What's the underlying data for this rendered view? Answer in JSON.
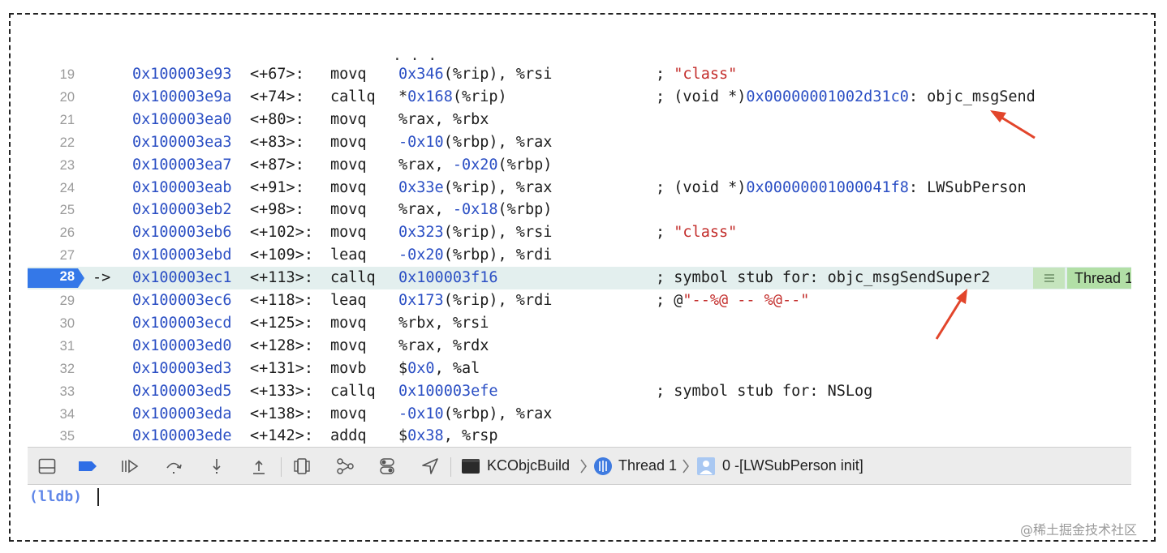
{
  "disassembly": {
    "partial_top_text": ".  .  .",
    "rows": [
      {
        "line": "19",
        "addr": "0x100003e93",
        "offset": "<+67>:",
        "mnemonic": "movq",
        "op_a": "0x346",
        "op_b": "(%rip), %rsi",
        "op_c": "",
        "op_d": "",
        "cm_a": "; ",
        "cm_b": "",
        "cm_c": "\"class\"",
        "cm_d": ""
      },
      {
        "line": "20",
        "addr": "0x100003e9a",
        "offset": "<+74>:",
        "mnemonic": "callq",
        "op_a": "",
        "op_b": "*",
        "op_c": "0x168",
        "op_d": "(%rip)",
        "cm_a": "; (void *)",
        "cm_b": "0x00000001002d31c0",
        "cm_c": "",
        "cm_d": ": objc_msgSend"
      },
      {
        "line": "21",
        "addr": "0x100003ea0",
        "offset": "<+80>:",
        "mnemonic": "movq",
        "op_a": "",
        "op_b": "%rax, %rbx",
        "op_c": "",
        "op_d": "",
        "cm_a": "",
        "cm_b": "",
        "cm_c": "",
        "cm_d": ""
      },
      {
        "line": "22",
        "addr": "0x100003ea3",
        "offset": "<+83>:",
        "mnemonic": "movq",
        "op_a": "-0x10",
        "op_b": "(%rbp), %rax",
        "op_c": "",
        "op_d": "",
        "cm_a": "",
        "cm_b": "",
        "cm_c": "",
        "cm_d": ""
      },
      {
        "line": "23",
        "addr": "0x100003ea7",
        "offset": "<+87>:",
        "mnemonic": "movq",
        "op_a": "",
        "op_b": "%rax, ",
        "op_c": "-0x20",
        "op_d": "(%rbp)",
        "cm_a": "",
        "cm_b": "",
        "cm_c": "",
        "cm_d": ""
      },
      {
        "line": "24",
        "addr": "0x100003eab",
        "offset": "<+91>:",
        "mnemonic": "movq",
        "op_a": "0x33e",
        "op_b": "(%rip), %rax",
        "op_c": "",
        "op_d": "",
        "cm_a": "; (void *)",
        "cm_b": "0x00000001000041f8",
        "cm_c": "",
        "cm_d": ": LWSubPerson"
      },
      {
        "line": "25",
        "addr": "0x100003eb2",
        "offset": "<+98>:",
        "mnemonic": "movq",
        "op_a": "",
        "op_b": "%rax, ",
        "op_c": "-0x18",
        "op_d": "(%rbp)",
        "cm_a": "",
        "cm_b": "",
        "cm_c": "",
        "cm_d": ""
      },
      {
        "line": "26",
        "addr": "0x100003eb6",
        "offset": "<+102>:",
        "mnemonic": "movq",
        "op_a": "0x323",
        "op_b": "(%rip), %rsi",
        "op_c": "",
        "op_d": "",
        "cm_a": "; ",
        "cm_b": "",
        "cm_c": "\"class\"",
        "cm_d": ""
      },
      {
        "line": "27",
        "addr": "0x100003ebd",
        "offset": "<+109>:",
        "mnemonic": "leaq",
        "op_a": "-0x20",
        "op_b": "(%rbp), %rdi",
        "op_c": "",
        "op_d": "",
        "cm_a": "",
        "cm_b": "",
        "cm_c": "",
        "cm_d": ""
      },
      {
        "line": "28",
        "addr": "0x100003ec1",
        "offset": "<+113>:",
        "mnemonic": "callq",
        "op_a": "0x100003f16",
        "op_b": "",
        "op_c": "",
        "op_d": "",
        "cm_a": "; symbol stub for: objc_msgSendSuper2",
        "cm_b": "",
        "cm_c": "",
        "cm_d": "",
        "current": true,
        "arrow": "->"
      },
      {
        "line": "29",
        "addr": "0x100003ec6",
        "offset": "<+118>:",
        "mnemonic": "leaq",
        "op_a": "0x173",
        "op_b": "(%rip), %rdi",
        "op_c": "",
        "op_d": "",
        "cm_a": "; @",
        "cm_b": "",
        "cm_c": "\"--%@ -- %@--\"",
        "cm_d": ""
      },
      {
        "line": "30",
        "addr": "0x100003ecd",
        "offset": "<+125>:",
        "mnemonic": "movq",
        "op_a": "",
        "op_b": "%rbx, %rsi",
        "op_c": "",
        "op_d": "",
        "cm_a": "",
        "cm_b": "",
        "cm_c": "",
        "cm_d": ""
      },
      {
        "line": "31",
        "addr": "0x100003ed0",
        "offset": "<+128>:",
        "mnemonic": "movq",
        "op_a": "",
        "op_b": "%rax, %rdx",
        "op_c": "",
        "op_d": "",
        "cm_a": "",
        "cm_b": "",
        "cm_c": "",
        "cm_d": ""
      },
      {
        "line": "32",
        "addr": "0x100003ed3",
        "offset": "<+131>:",
        "mnemonic": "movb",
        "op_a": "",
        "op_b": "$",
        "op_c": "0x0",
        "op_d": ", %al",
        "cm_a": "",
        "cm_b": "",
        "cm_c": "",
        "cm_d": ""
      },
      {
        "line": "33",
        "addr": "0x100003ed5",
        "offset": "<+133>:",
        "mnemonic": "callq",
        "op_a": "0x100003efe",
        "op_b": "",
        "op_c": "",
        "op_d": "",
        "cm_a": "; symbol stub for: NSLog",
        "cm_b": "",
        "cm_c": "",
        "cm_d": ""
      },
      {
        "line": "34",
        "addr": "0x100003eda",
        "offset": "<+138>:",
        "mnemonic": "movq",
        "op_a": "-0x10",
        "op_b": "(%rbp), %rax",
        "op_c": "",
        "op_d": "",
        "cm_a": "",
        "cm_b": "",
        "cm_c": "",
        "cm_d": ""
      },
      {
        "line": "35",
        "addr": "0x100003ede",
        "offset": "<+142>:",
        "mnemonic": "addq",
        "op_a": "",
        "op_b": "$",
        "op_c": "0x38",
        "op_d": ", %rsp",
        "cm_a": "",
        "cm_b": "",
        "cm_c": "",
        "cm_d": ""
      }
    ],
    "thread_badge": "Thread 1"
  },
  "debug_bar": {
    "icons": [
      "hide-debug-area-icon",
      "breakpoints-toggle-icon",
      "continue-icon",
      "step-over-icon",
      "step-into-icon",
      "step-out-icon",
      "view-debugger-icon",
      "memory-graph-icon",
      "environment-overrides-icon",
      "simulate-location-icon"
    ],
    "breadcrumb": {
      "target": "KCObjcBuild",
      "thread": "Thread 1",
      "frame": "0 -[LWSubPerson init]"
    }
  },
  "console": {
    "prompt": "(lldb)"
  },
  "watermark": "@稀土掘金技术社区",
  "colors": {
    "address": "#2b4fc4",
    "string": "#c32d2b",
    "current_line_bg": "#e3efee",
    "pc_marker": "#3478e8",
    "thread_badge": "#b2dfa6",
    "annotation_arrow": "#e2452b",
    "prompt": "#5f86e8"
  }
}
